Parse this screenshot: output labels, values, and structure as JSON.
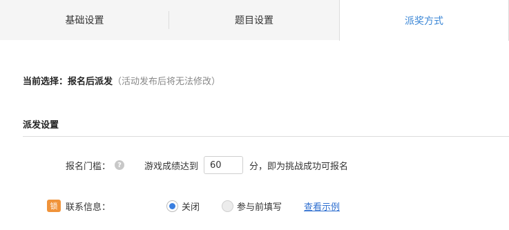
{
  "tabs": [
    {
      "label": "基础设置"
    },
    {
      "label": "题目设置"
    },
    {
      "label": "派奖方式"
    }
  ],
  "current_selection": {
    "label": "当前选择：报名后派发",
    "note": "（活动发布后将无法修改）"
  },
  "section": {
    "title": "派发设置"
  },
  "signup_threshold": {
    "label": "报名门槛：",
    "help_icon": "?",
    "prefix": "游戏成绩达到",
    "value": "60",
    "suffix": "分，即为挑战成功可报名"
  },
  "contact_info": {
    "badge": "锁",
    "label": "联系信息：",
    "options": [
      {
        "label": "关闭",
        "checked": true
      },
      {
        "label": "参与前填写",
        "checked": false
      }
    ],
    "example_link": "查看示例"
  },
  "colors": {
    "accent_blue": "#3a86d6",
    "badge_orange": "#f0933a"
  }
}
